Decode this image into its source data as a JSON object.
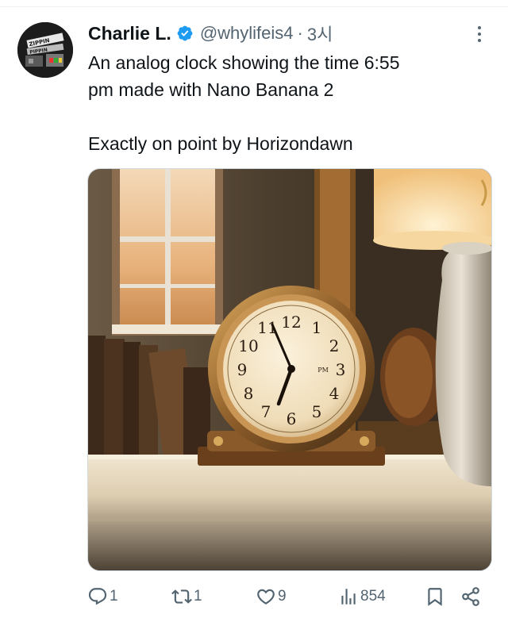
{
  "author": {
    "name": "Charlie L.",
    "handle": "@whylifeis4",
    "separator": "·",
    "time": "3시",
    "avatar_text": "ZIPPIN' PIPPIN'"
  },
  "tweet": {
    "line1": "An analog clock showing the time 6:55",
    "line2": "pm made with Nano Banana 2",
    "line3": "Exactly on point by Horizondawn"
  },
  "image": {
    "clock_numerals": [
      "12",
      "1",
      "2",
      "3",
      "4",
      "5",
      "6",
      "7",
      "8",
      "9",
      "10",
      "11"
    ],
    "clock_label": "PM",
    "clock_time": "6:55"
  },
  "actions": {
    "replies": "1",
    "reposts": "1",
    "likes": "9",
    "views": "854"
  },
  "colors": {
    "text": "#0f1419",
    "secondary": "#536471",
    "verified": "#1d9bf0"
  },
  "icons": [
    "verified-badge-icon",
    "more-icon",
    "reply-icon",
    "repost-icon",
    "like-icon",
    "views-icon",
    "bookmark-icon",
    "share-icon"
  ]
}
